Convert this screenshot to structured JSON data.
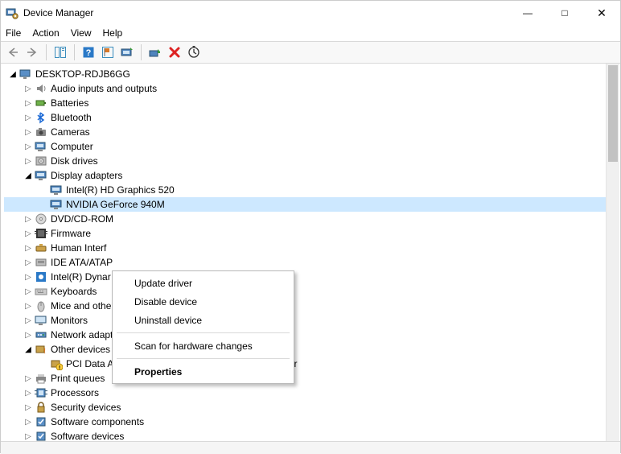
{
  "window": {
    "title": "Device Manager"
  },
  "menubar": [
    "File",
    "Action",
    "View",
    "Help"
  ],
  "tree": {
    "root": {
      "label": "DESKTOP-RDJB6GG",
      "expanded": true
    },
    "items": [
      {
        "label": "Audio inputs and outputs",
        "icon": "audio",
        "arrow": "closed"
      },
      {
        "label": "Batteries",
        "icon": "battery",
        "arrow": "closed"
      },
      {
        "label": "Bluetooth",
        "icon": "bluetooth",
        "arrow": "closed"
      },
      {
        "label": "Cameras",
        "icon": "camera",
        "arrow": "closed"
      },
      {
        "label": "Computer",
        "icon": "computer",
        "arrow": "closed"
      },
      {
        "label": "Disk drives",
        "icon": "disk",
        "arrow": "closed"
      },
      {
        "label": "Display adapters",
        "icon": "display",
        "arrow": "open",
        "children": [
          {
            "label": "Intel(R) HD Graphics 520",
            "icon": "display"
          },
          {
            "label": "NVIDIA GeForce 940M",
            "icon": "display",
            "selected": true
          }
        ]
      },
      {
        "label": "DVD/CD-ROM",
        "icon": "dvd",
        "arrow": "closed"
      },
      {
        "label": "Firmware",
        "icon": "firmware",
        "arrow": "closed"
      },
      {
        "label": "Human Interf",
        "icon": "hid",
        "arrow": "closed"
      },
      {
        "label": "IDE ATA/ATAP",
        "icon": "ide",
        "arrow": "closed"
      },
      {
        "label": "Intel(R) Dynar",
        "icon": "intel",
        "arrow": "closed"
      },
      {
        "label": "Keyboards",
        "icon": "keyboard",
        "arrow": "closed"
      },
      {
        "label": "Mice and othe",
        "icon": "mouse",
        "arrow": "closed"
      },
      {
        "label": "Monitors",
        "icon": "monitor",
        "arrow": "closed"
      },
      {
        "label": "Network adapters",
        "icon": "network",
        "arrow": "closed"
      },
      {
        "label": "Other devices",
        "icon": "other",
        "arrow": "open",
        "children": [
          {
            "label": "PCI Data Acquisition and Signal Processing Controller",
            "icon": "other-warn"
          }
        ]
      },
      {
        "label": "Print queues",
        "icon": "printer",
        "arrow": "closed"
      },
      {
        "label": "Processors",
        "icon": "cpu",
        "arrow": "closed"
      },
      {
        "label": "Security devices",
        "icon": "security",
        "arrow": "closed"
      },
      {
        "label": "Software components",
        "icon": "software",
        "arrow": "closed"
      },
      {
        "label": "Software devices",
        "icon": "software",
        "arrow": "closed"
      }
    ]
  },
  "context_menu": {
    "items": [
      {
        "label": "Update driver",
        "highlight": true
      },
      {
        "label": "Disable device"
      },
      {
        "label": "Uninstall device"
      },
      {
        "sep": true
      },
      {
        "label": "Scan for hardware changes"
      },
      {
        "sep": true
      },
      {
        "label": "Properties",
        "bold": true
      }
    ]
  }
}
